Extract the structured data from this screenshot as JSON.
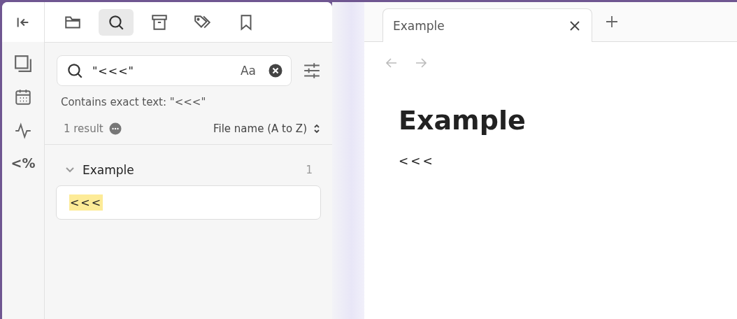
{
  "ribbon": {
    "items": [
      {
        "kind": "pages"
      },
      {
        "kind": "calendar"
      },
      {
        "kind": "activity"
      },
      {
        "kind": "text",
        "label": "<%"
      }
    ]
  },
  "sidebar_tabs": [
    {
      "kind": "folder",
      "selected": false
    },
    {
      "kind": "search",
      "selected": true
    },
    {
      "kind": "archive",
      "selected": false
    },
    {
      "kind": "tags",
      "selected": false
    },
    {
      "kind": "bookmark",
      "selected": false
    }
  ],
  "search": {
    "value": "\"<<<\"",
    "case_button": "Aa",
    "summary": "Contains exact text: \"<<<\"",
    "result_count": "1 result",
    "sort": "File name (A to Z)"
  },
  "results": [
    {
      "file": "Example",
      "count": "1",
      "expanded": true,
      "matches": [
        {
          "text": "<<<",
          "highlighted": true
        }
      ]
    }
  ],
  "editor": {
    "tabs": [
      {
        "title": "Example",
        "selected": true
      }
    ],
    "back_disabled": true,
    "forward_disabled": true,
    "title": "Example",
    "body": "<<<"
  }
}
